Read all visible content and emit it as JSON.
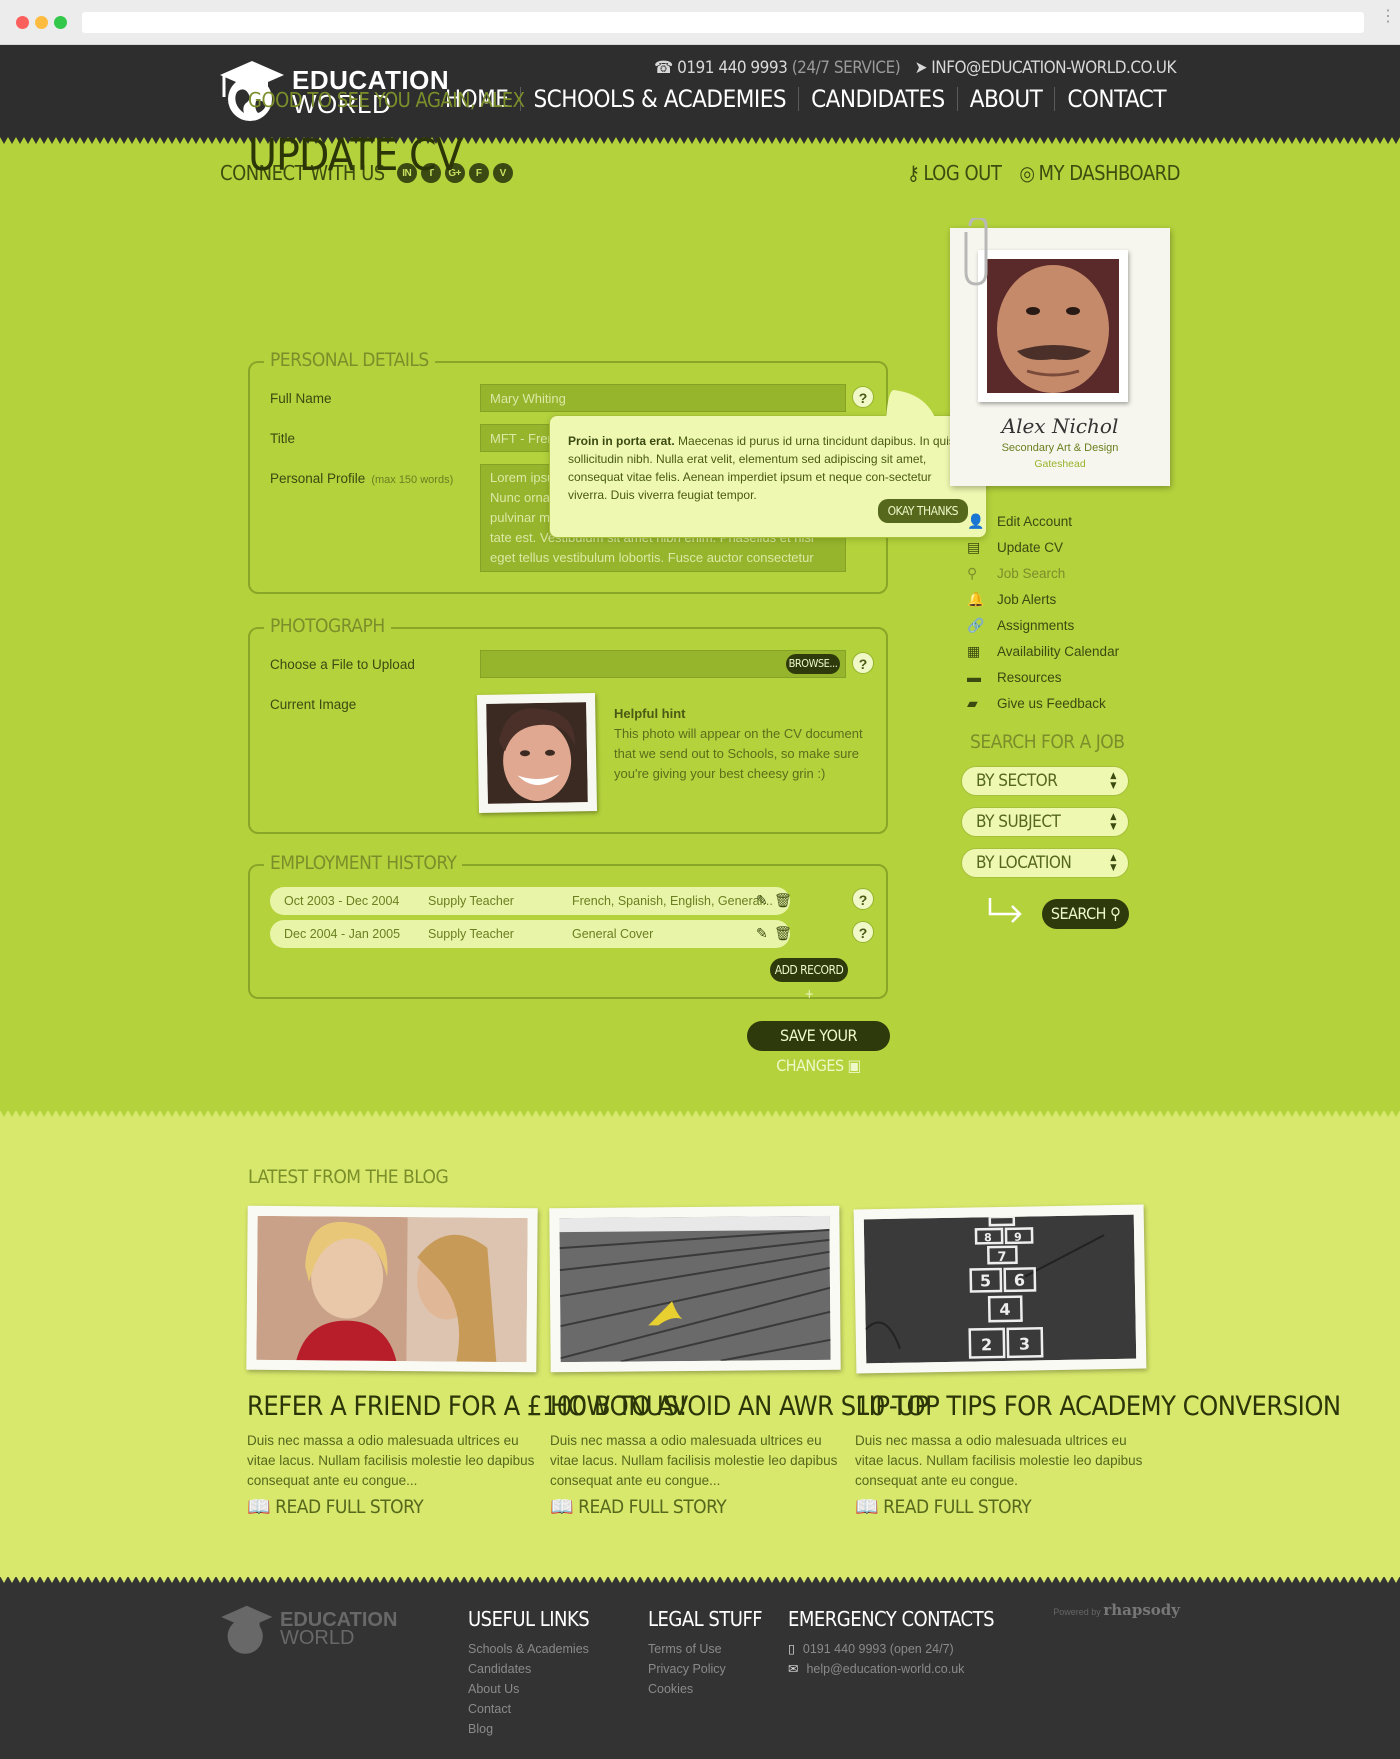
{
  "header": {
    "logo_line1": "EDUCATION",
    "logo_line2": "WORLD",
    "phone": "0191 440 9993",
    "phone_note": "(24/7 SERVICE)",
    "email": "INFO@EDUCATION-WORLD.CO.UK",
    "nav": [
      "HOME",
      "SCHOOLS & ACADEMIES",
      "CANDIDATES",
      "ABOUT",
      "CONTACT"
    ]
  },
  "topbar": {
    "connect_label": "CONNECT WITH US",
    "social": [
      "in",
      "t",
      "g+",
      "f",
      "v"
    ],
    "logout": "LOG OUT",
    "dashboard": "MY DASHBOARD"
  },
  "page": {
    "greeting": "GOOD TO SEE YOU AGAIN, ALEX",
    "title": "UPDATE CV"
  },
  "personal": {
    "legend": "PERSONAL DETAILS",
    "full_name_label": "Full Name",
    "full_name_value": "Mary Whiting",
    "title_label": "Title",
    "title_value": "MFT - French",
    "profile_label": "Personal Profile",
    "profile_note": "(max 150 words)",
    "profile_lines": [
      "Lorem ipsum dolor sit amet, consectetur",
      "Nunc ornare aliquet risus, sit amet",
      "pulvinar mi volutpat in. Integer accumsan",
      "tate est. Vestibulum sit amet nibh enim. Phasellus et nisl",
      "eget tellus vestibulum lobortis. Fusce auctor consectetur"
    ]
  },
  "tooltip": {
    "bold": "Proin in porta erat.",
    "text": "Maecenas id purus id urna tincidunt dapibus. In quis sollicitudin nibh. Nulla erat velit, elementum sed adipiscing sit amet, consequat vitae felis. Aenean imperdiet ipsum et neque con-sectetur viverra. Duis viverra feugiat tempor.",
    "button": "OKAY THANKS"
  },
  "photograph": {
    "legend": "PHOTOGRAPH",
    "upload_label": "Choose a File to Upload",
    "browse": "BROWSE...",
    "current_label": "Current Image",
    "hint_title": "Helpful hint",
    "hint_text": "This photo will appear on the CV document that we send out to Schools, so make sure you're giving your best cheesy grin :)"
  },
  "employment": {
    "legend": "EMPLOYMENT HISTORY",
    "rows": [
      {
        "dates": "Oct 2003 - Dec 2004",
        "role": "Supply Teacher",
        "subjects": "French, Spanish, English, General..."
      },
      {
        "dates": "Dec 2004 - Jan 2005",
        "role": "Supply Teacher",
        "subjects": "General Cover"
      }
    ],
    "add": "ADD RECORD +"
  },
  "save": "SAVE YOUR CHANGES",
  "profile": {
    "name": "Alex Nichol",
    "role": "Secondary Art & Design",
    "location": "Gateshead"
  },
  "sidemenu": [
    {
      "label": "Edit Account",
      "icon": "user-icon"
    },
    {
      "label": "Update CV",
      "icon": "cv-icon"
    },
    {
      "label": "Job Search",
      "icon": "search-icon"
    },
    {
      "label": "Job Alerts",
      "icon": "bell-icon"
    },
    {
      "label": "Assignments",
      "icon": "link-icon"
    },
    {
      "label": "Availability Calendar",
      "icon": "calendar-icon"
    },
    {
      "label": "Resources",
      "icon": "folder-icon"
    },
    {
      "label": "Give us Feedback",
      "icon": "chat-icon"
    }
  ],
  "job_search": {
    "heading": "SEARCH FOR A JOB",
    "selects": [
      "BY SECTOR",
      "BY SUBJECT",
      "BY LOCATION"
    ],
    "button": "SEARCH"
  },
  "blog": {
    "heading": "LATEST FROM THE BLOG",
    "posts": [
      {
        "title": "REFER A FRIEND FOR A £100 BONUS!",
        "text": "Duis nec massa a odio malesuada ultrices eu vitae lacus. Nullam facilisis molestie leo dapibus consequat ante eu congue...",
        "more": "READ FULL STORY"
      },
      {
        "title": "HOW TO AVOID AN AWR SLIP-UP",
        "text": "Duis nec massa a odio malesuada ultrices eu vitae lacus. Nullam facilisis molestie leo dapibus consequat ante eu congue...",
        "more": "READ FULL STORY"
      },
      {
        "title": "10 TOP TIPS FOR ACADEMY CONVERSION",
        "text": "Duis nec massa a odio malesuada ultrices eu vitae lacus. Nullam facilisis molestie leo dapibus consequat ante eu congue.",
        "more": "READ FULL STORY"
      }
    ]
  },
  "footer": {
    "logo_line1": "EDUCATION",
    "logo_line2": "WORLD",
    "useful_heading": "USEFUL LINKS",
    "useful_links": [
      "Schools & Academies",
      "Candidates",
      "About Us",
      "Contact",
      "Blog"
    ],
    "legal_heading": "LEGAL STUFF",
    "legal_links": [
      "Terms of Use",
      "Privacy Policy",
      "Cookies"
    ],
    "emergency_heading": "EMERGENCY CONTACTS",
    "emergency_phone": "0191 440 9993 (open 24/7)",
    "emergency_email": "help@education-world.co.uk",
    "powered_label": "Powered by",
    "powered_brand": "rhapsody"
  },
  "colors": {
    "header_bg": "#2e2e2e",
    "main_green": "#b4d23c",
    "blog_green": "#d8e86c",
    "dark_olive": "#2f3a0c",
    "footer_bg": "#333333"
  }
}
